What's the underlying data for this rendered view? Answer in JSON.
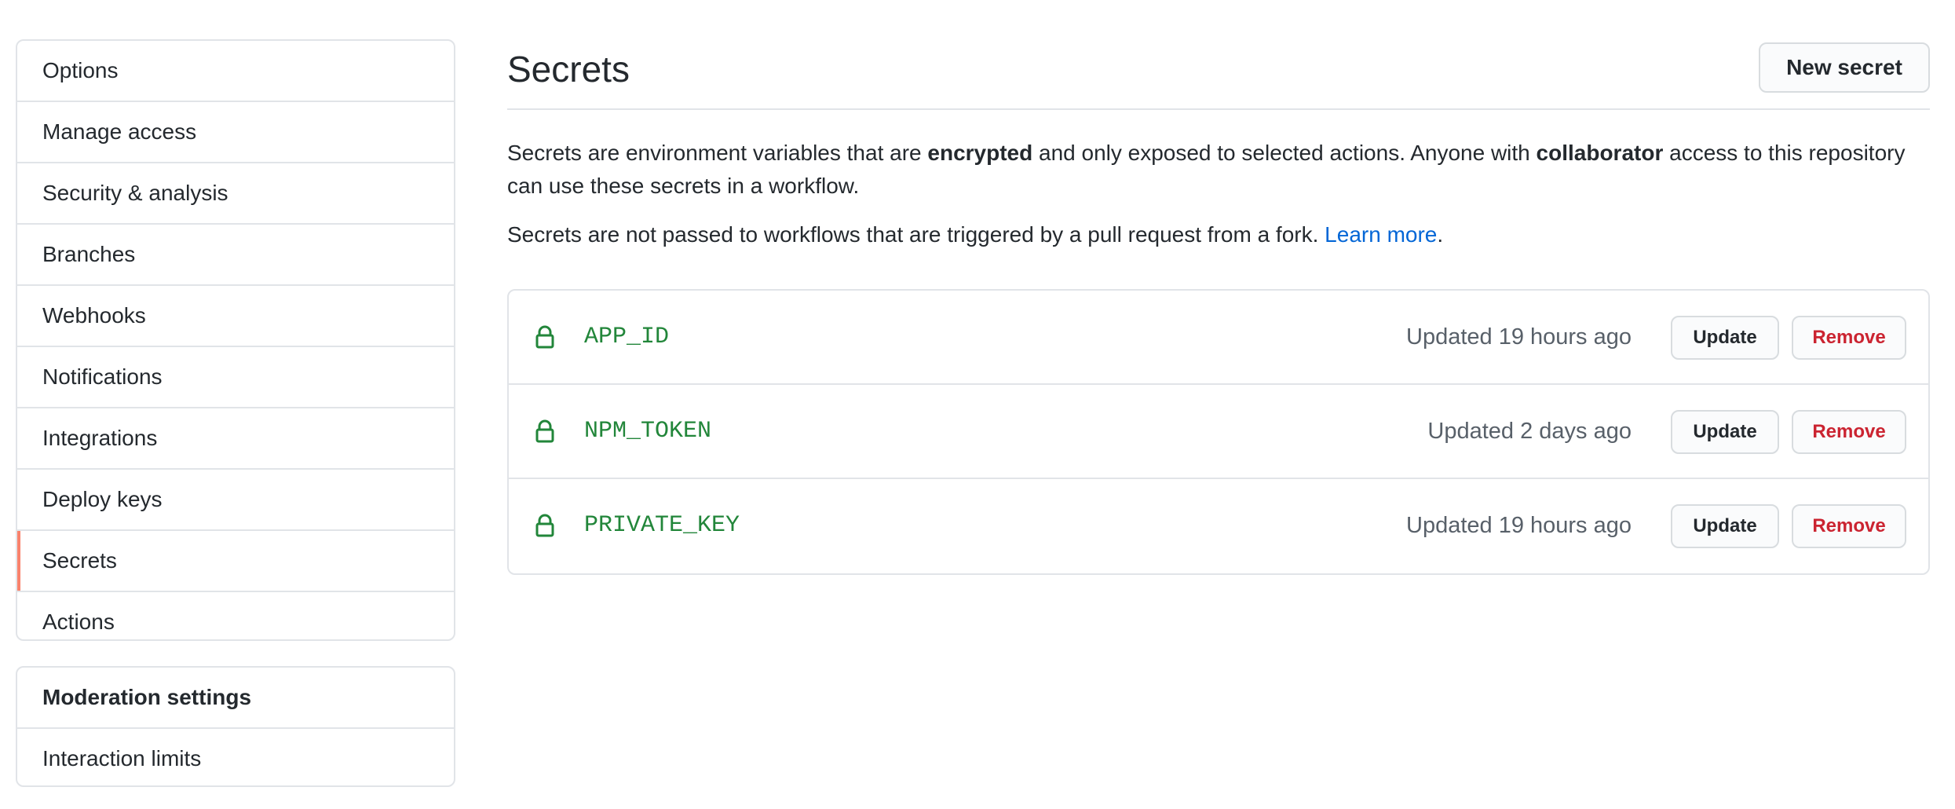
{
  "sidebar": {
    "items": [
      {
        "label": "Options"
      },
      {
        "label": "Manage access"
      },
      {
        "label": "Security & analysis"
      },
      {
        "label": "Branches"
      },
      {
        "label": "Webhooks"
      },
      {
        "label": "Notifications"
      },
      {
        "label": "Integrations"
      },
      {
        "label": "Deploy keys"
      },
      {
        "label": "Secrets",
        "selected": true
      },
      {
        "label": "Actions"
      }
    ],
    "moderation": {
      "heading": "Moderation settings",
      "items": [
        {
          "label": "Interaction limits"
        }
      ]
    }
  },
  "main": {
    "title": "Secrets",
    "new_secret_label": "New secret",
    "description": {
      "p1_part1": "Secrets are environment variables that are ",
      "p1_bold1": "encrypted",
      "p1_part2": " and only exposed to selected actions. Anyone with ",
      "p1_bold2": "collaborator",
      "p1_part3": " access to this repository can use these secrets in a workflow.",
      "p2_text": "Secrets are not passed to workflows that are triggered by a pull request from a fork. ",
      "p2_link": "Learn more",
      "p2_end": "."
    },
    "secrets": [
      {
        "name": "APP_ID",
        "updated": "Updated 19 hours ago",
        "update_label": "Update",
        "remove_label": "Remove"
      },
      {
        "name": "NPM_TOKEN",
        "updated": "Updated 2 days ago",
        "update_label": "Update",
        "remove_label": "Remove"
      },
      {
        "name": "PRIVATE_KEY",
        "updated": "Updated 19 hours ago",
        "update_label": "Update",
        "remove_label": "Remove"
      }
    ]
  },
  "colors": {
    "selected_accent": "#f9826c",
    "secret_name": "#22863a",
    "link": "#0366d6",
    "danger": "#cb2431"
  },
  "icons": {
    "secret_icon": "lock-icon"
  }
}
